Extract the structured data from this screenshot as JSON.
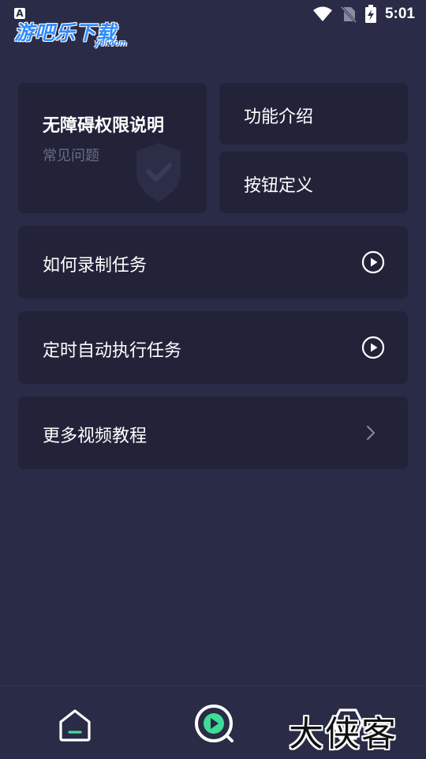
{
  "status_bar": {
    "notification_glyph": "A",
    "time": "5:01",
    "icons": [
      "wifi-icon",
      "no-sim-icon",
      "battery-charging-icon"
    ]
  },
  "watermark": {
    "main": "游吧乐下载",
    "sub": "y8l.com"
  },
  "cards": {
    "permissions": {
      "title": "无障碍权限说明",
      "subtitle": "常见问题",
      "icon": "shield-check-icon"
    },
    "feature_intro": {
      "label": "功能介绍"
    },
    "button_definition": {
      "label": "按钮定义"
    }
  },
  "tutorials": [
    {
      "label": "如何录制任务",
      "icon": "play-circle-icon"
    },
    {
      "label": "定时自动执行任务",
      "icon": "play-circle-icon"
    },
    {
      "label": "更多视频教程",
      "icon": "chevron-right-icon"
    }
  ],
  "bottom_nav": {
    "items": [
      "home-icon",
      "record-play-icon",
      "profile-icon"
    ],
    "accent_color": "#3ddc97",
    "overlay_text": "大侠客"
  },
  "colors": {
    "background": "#2a2b46",
    "card": "#222339",
    "muted_text": "#6b6d86"
  }
}
